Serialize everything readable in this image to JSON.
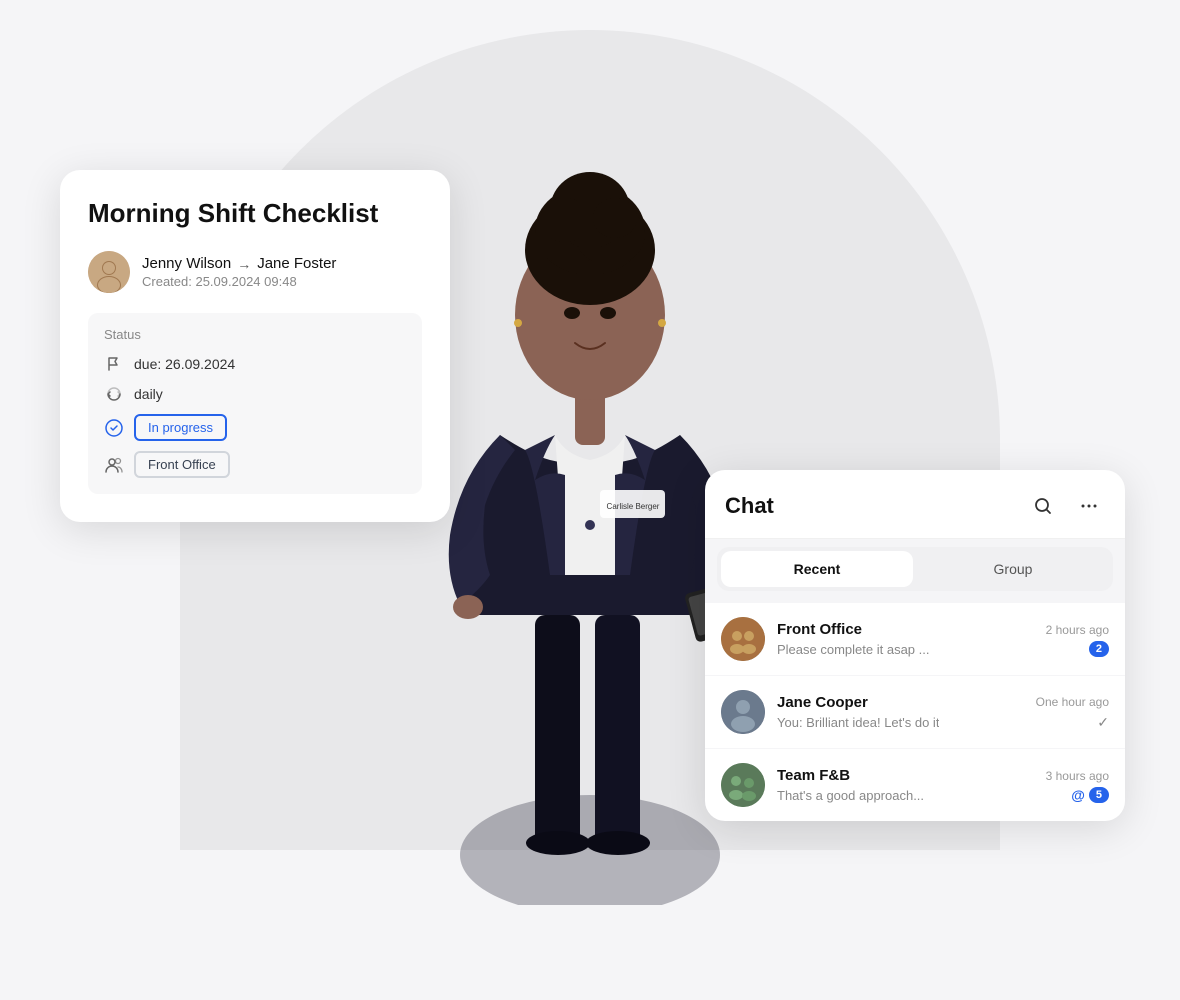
{
  "checklist": {
    "title": "Morning Shift Checklist",
    "from_user": "Jenny Wilson",
    "to_user": "Jane Foster",
    "arrow": "→",
    "created_label": "Created: 25.09.2024 09:48",
    "status_section_label": "Status",
    "due_label": "due: 26.09.2024",
    "recurrence_label": "daily",
    "progress_badge": "In progress",
    "department_badge": "Front Office"
  },
  "chat": {
    "title": "Chat",
    "tabs": [
      {
        "label": "Recent",
        "active": true
      },
      {
        "label": "Group",
        "active": false
      }
    ],
    "items": [
      {
        "name": "Front Office",
        "time": "2 hours ago",
        "preview": "Please complete it asap ...",
        "unread": "2",
        "type": "group"
      },
      {
        "name": "Jane Cooper",
        "time": "One hour ago",
        "preview": "You: Brilliant idea! Let's do it",
        "unread": null,
        "check": true,
        "type": "person"
      },
      {
        "name": "Team F&B",
        "time": "3 hours ago",
        "preview": "That's a good approach...",
        "mention": true,
        "unread": "5",
        "type": "group"
      }
    ]
  }
}
